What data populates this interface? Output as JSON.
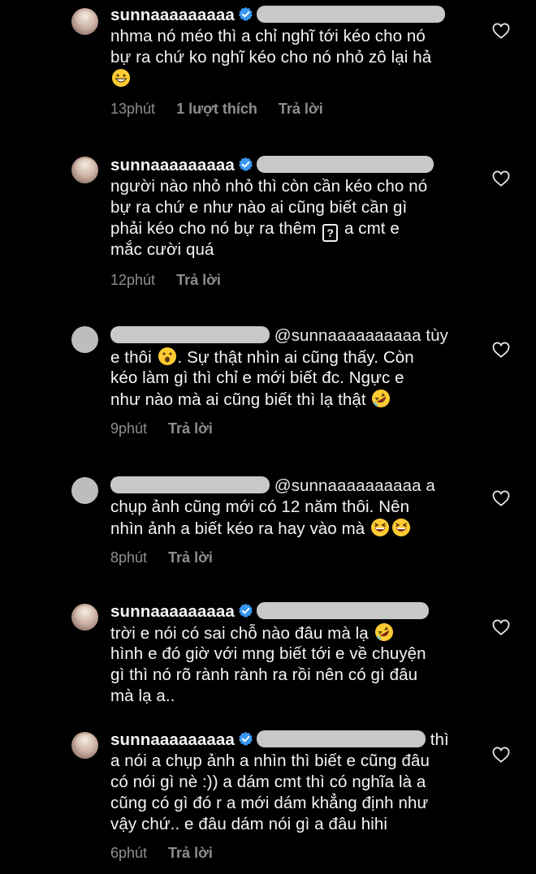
{
  "icons": {
    "verified": "verified-badge-icon",
    "like": "heart-outline-icon",
    "emoji_grin": "grinning-face-emoji",
    "emoji_rofl": "rolling-on-floor-laughing-emoji",
    "emoji_wow": "face-with-open-mouth-emoji",
    "emoji_squint": "grinning-squinting-face-emoji",
    "unknown_glyph": "unknown-glyph-box"
  },
  "colors": {
    "background": "#000000",
    "text": "#f5f5f5",
    "meta": "#8e8e8e",
    "verified": "#3897f0",
    "redaction": "#c8c8c8"
  },
  "comments": [
    {
      "username": "sunnaaaaaaaaa",
      "lines": [
        "nhma nó méo thì a chỉ nghĩ tới kéo cho nó",
        "bự ra chứ ko nghĩ kéo cho nó nhỏ zô lại hả"
      ],
      "time": "13phút",
      "likes": "1 lượt thích",
      "reply": "Trả lời"
    },
    {
      "username": "sunnaaaaaaaaa",
      "lines": [
        "người nào nhỏ nhỏ thì còn cần kéo cho nó",
        "bự ra chứ e như nào ai cũng biết cần gì",
        "phải kéo cho nó bự ra thêm",
        "a cmt e",
        "mắc cười quá"
      ],
      "glyph": "?",
      "time": "12phút",
      "reply": "Trả lời"
    },
    {
      "mention": "@sunnaaaaaaaaaa tùy",
      "lines": [
        "e thôi",
        ". Sự thật nhìn ai cũng thấy. Còn",
        "kéo làm gì thì chỉ e mới biết đc. Ngực e",
        "như nào mà ai cũng biết thì lạ thật"
      ],
      "time": "9phút",
      "reply": "Trả lời"
    },
    {
      "mention": "@sunnaaaaaaaaaa a",
      "lines": [
        "chụp ảnh cũng mới có 12 năm thôi. Nên",
        "nhìn ảnh a biết kéo ra hay vào mà"
      ],
      "time": "8phút",
      "reply": "Trả lời"
    },
    {
      "username": "sunnaaaaaaaaa",
      "lines": [
        "trời e nói có sai chỗ nào đâu mà lạ",
        "hình e đó giờ với mng biết tới e về chuyện",
        "gì thì nó rõ rành rành ra rồi nên có gì đâu",
        "mà lạ a.."
      ],
      "time": "",
      "reply": ""
    },
    {
      "username": "sunnaaaaaaaaa",
      "tail": "thì",
      "lines": [
        "a nói a chụp ảnh a nhìn thì biết e cũng đâu",
        "có nói gì nè :)) a dám cmt thì có nghĩa là a",
        "cũng có gì đó r a mới dám khẳng định như",
        "vậy chứ.. e đâu dám nói gì a đâu hihi"
      ],
      "time": "6phút",
      "reply": "Trả lời"
    }
  ]
}
